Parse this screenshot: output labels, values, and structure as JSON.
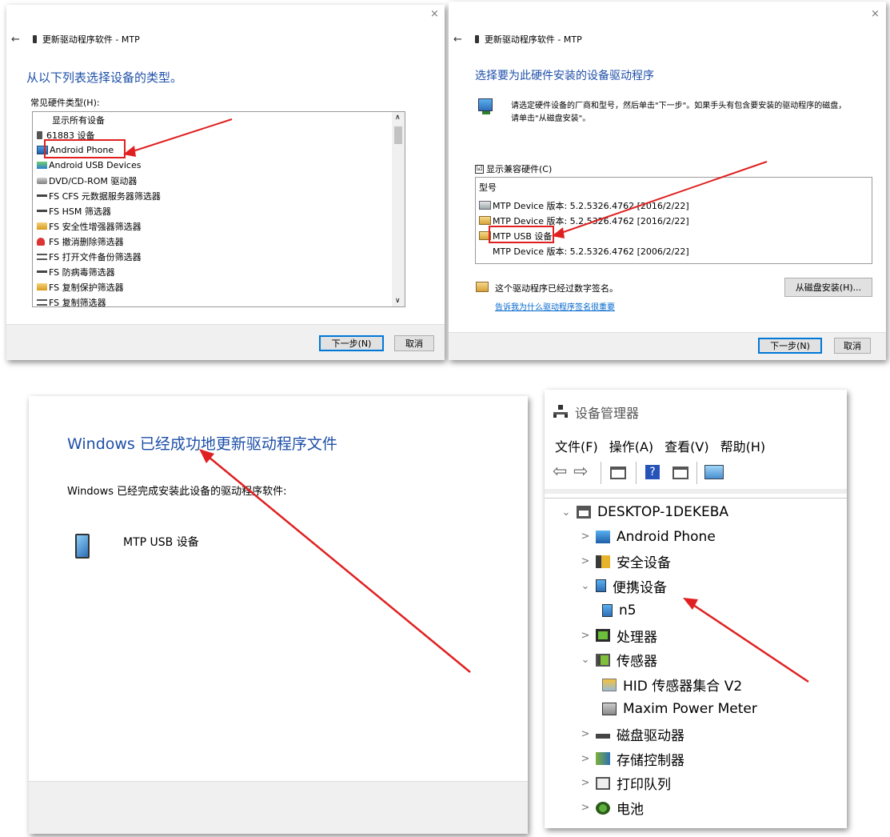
{
  "wizard1": {
    "title": "更新驱动程序软件 - MTP",
    "heading": "从以下列表选择设备的类型。",
    "list_label": "常见硬件类型(H):",
    "items": [
      "显示所有设备",
      "61883 设备",
      "Android Phone",
      "Android USB Devices",
      "DVD/CD-ROM 驱动器",
      "FS CFS 元数据服务器筛选器",
      "FS HSM 筛选器",
      "FS 安全性增强器筛选器",
      "FS 撤消删除筛选器",
      "FS 打开文件备份筛选器",
      "FS 防病毒筛选器",
      "FS 复制保护筛选器",
      "FS 复制筛选器"
    ],
    "icons": [
      "none",
      "usb-plug",
      "phone",
      "network",
      "disk",
      "flat",
      "flat",
      "folder",
      "red-person",
      "stack",
      "flat",
      "folder",
      "stack"
    ],
    "next_button": "下一步(N)",
    "cancel_button": "取消",
    "close": "×",
    "back": "←"
  },
  "wizard2": {
    "title": "更新驱动程序软件 - MTP",
    "heading": "选择要为此硬件安装的设备驱动程序",
    "instruction_line1": "请选定硬件设备的厂商和型号，然后单击\"下一步\"。如果手头有包含要安装的驱动程序的磁盘，",
    "instruction_line2": "请单击\"从磁盘安装\"。",
    "compat_checkbox": "显示兼容硬件(C)",
    "compat_checked": "☑",
    "model_header": "型号",
    "models": [
      "MTP Device 版本: 5.2.5326.4762 [2016/2/22]",
      "MTP Device 版本: 5.2.5326.4762 [2016/2/22]",
      "MTP USB 设备",
      "MTP Device 版本: 5.2.5326.4762 [2006/2/22]"
    ],
    "signed_text": "这个驱动程序已经过数字签名。",
    "have_disk_button": "从磁盘安装(H)...",
    "signing_link": "告诉我为什么驱动程序签名很重要",
    "next_button": "下一步(N)",
    "cancel_button": "取消",
    "close": "×",
    "back": "←"
  },
  "success": {
    "heading": "Windows 已经成功地更新驱动程序文件",
    "message": "Windows 已经完成安装此设备的驱动程序软件:",
    "device_name": "MTP USB 设备"
  },
  "device_manager": {
    "title": "设备管理器",
    "menu": [
      "文件(F)",
      "操作(A)",
      "查看(V)",
      "帮助(H)"
    ],
    "toolbar": {
      "back": "⇦",
      "forward": "⇨",
      "help": "?"
    },
    "tree": [
      {
        "label": "DESKTOP-1DEKEBA",
        "chevron": "⌄",
        "icon": "computer"
      },
      {
        "label": "Android Phone",
        "chevron": ">",
        "icon": "android"
      },
      {
        "label": "安全设备",
        "chevron": ">",
        "icon": "security"
      },
      {
        "label": "便携设备",
        "chevron": "⌄",
        "icon": "portable"
      },
      {
        "label": "n5",
        "chevron": "",
        "icon": "portable"
      },
      {
        "label": "处理器",
        "chevron": ">",
        "icon": "cpu"
      },
      {
        "label": "传感器",
        "chevron": "⌄",
        "icon": "sensor"
      },
      {
        "label": "HID 传感器集合 V2",
        "chevron": "",
        "icon": "hid"
      },
      {
        "label": "Maxim Power Meter",
        "chevron": "",
        "icon": "maxim"
      },
      {
        "label": "磁盘驱动器",
        "chevron": ">",
        "icon": "disk"
      },
      {
        "label": "存储控制器",
        "chevron": ">",
        "icon": "storage"
      },
      {
        "label": "打印队列",
        "chevron": ">",
        "icon": "printer"
      },
      {
        "label": "电池",
        "chevron": ">",
        "icon": "battery"
      }
    ]
  },
  "colors": {
    "heading_blue": "#1e4fa8",
    "annotation_red": "#e02020",
    "link_blue": "#0066cc",
    "focus_blue": "#0078d7"
  }
}
